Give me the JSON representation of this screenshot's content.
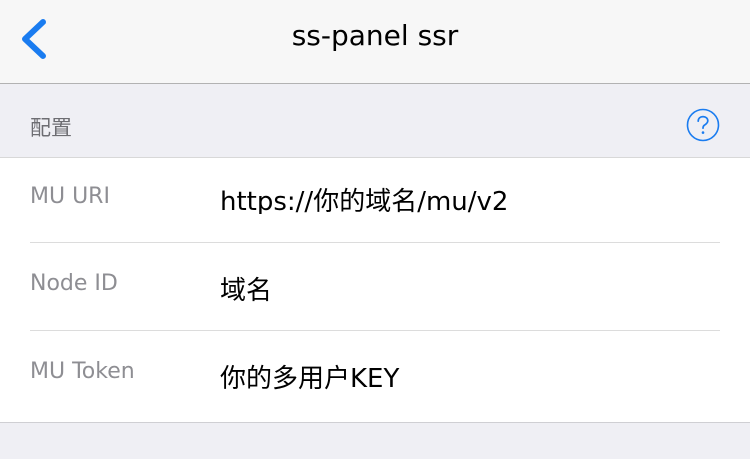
{
  "navbar": {
    "back_icon": "chevron-left-icon",
    "title": "ss-panel ssr"
  },
  "section": {
    "title": "配置",
    "help_icon": "question-circle-icon"
  },
  "fields": [
    {
      "label": "MU URI",
      "value": "https://你的域名/mu/v2"
    },
    {
      "label": "Node ID",
      "value": "域名"
    },
    {
      "label": "MU Token",
      "value": "你的多用户KEY"
    }
  ],
  "colors": {
    "accent": "#1a7cf0",
    "label_gray": "#8e8e93",
    "section_text": "#6d6d72",
    "background": "#efeff4"
  }
}
